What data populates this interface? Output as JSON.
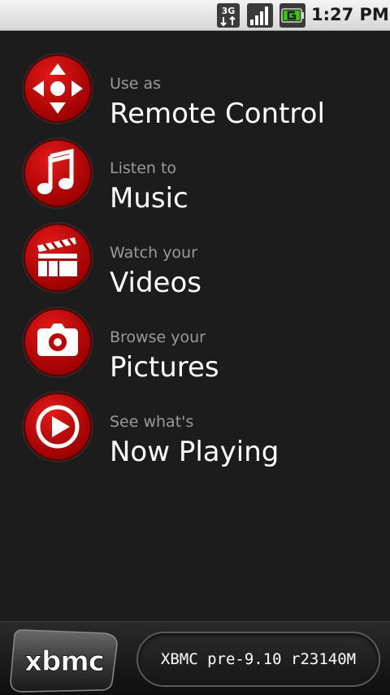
{
  "status_bar": {
    "network": "3G",
    "time": "1:27 PM",
    "icons": [
      "3g-icon",
      "signal-icon",
      "battery-charging-icon"
    ]
  },
  "menu": {
    "items": [
      {
        "subtitle": "Use as",
        "title": "Remote Control",
        "icon": "remote-dpad-icon"
      },
      {
        "subtitle": "Listen to",
        "title": "Music",
        "icon": "music-note-icon"
      },
      {
        "subtitle": "Watch your",
        "title": "Videos",
        "icon": "clapperboard-icon"
      },
      {
        "subtitle": "Browse your",
        "title": "Pictures",
        "icon": "camera-icon"
      },
      {
        "subtitle": "See what's",
        "title": "Now Playing",
        "icon": "play-icon"
      }
    ]
  },
  "footer": {
    "logo_text": "xbmc",
    "version": "XBMC pre-9.10 r23140M"
  },
  "colors": {
    "background": "#1c1c1c",
    "accent_red": "#c80000",
    "subtitle_gray": "#9a9a9a"
  }
}
